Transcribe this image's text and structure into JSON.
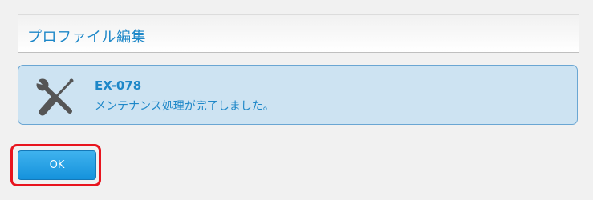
{
  "header": {
    "title": "プロファイル編集"
  },
  "message": {
    "icon": "tools-icon",
    "code": "EX-078",
    "text": "メンテナンス処理が完了しました。"
  },
  "actions": {
    "ok_label": "OK"
  },
  "colors": {
    "accent_text": "#1d87c8",
    "message_background": "#cde3f2",
    "message_border": "#6aa6d3",
    "button_background": "#1592dc",
    "focus_ring": "#e8141e",
    "icon": "#555555"
  }
}
